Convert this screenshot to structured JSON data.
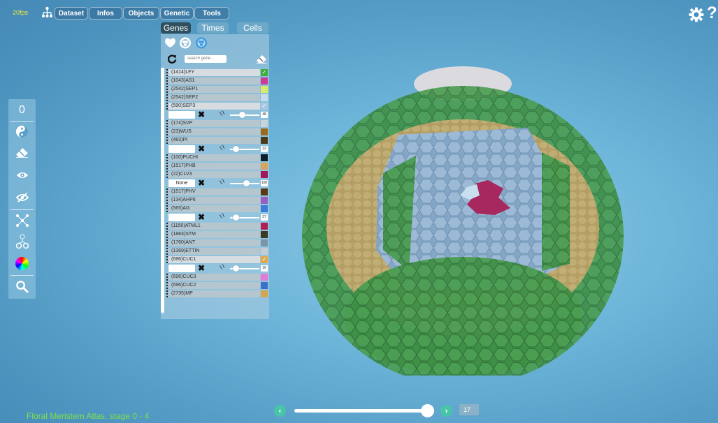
{
  "fps": "20fps",
  "menu": {
    "dataset": "Dataset",
    "infos": "Infos",
    "objects": "Objects",
    "genetic": "Genetic",
    "tools": "Tools"
  },
  "help_label": "?",
  "toolbar": {
    "counter": "0"
  },
  "tabs": {
    "genes": "Genes",
    "times": "Times",
    "cells": "Cells"
  },
  "search": {
    "placeholder": "search gene..."
  },
  "genes": [
    {
      "label": "(1414)LFY",
      "color": "#3fae3f",
      "checked": true,
      "highlight": true
    },
    {
      "label": "(1043)AS1",
      "color": "#cf3a98",
      "checked": false
    },
    {
      "label": "(2542)SEP1",
      "color": "#d8ec66",
      "checked": false
    },
    {
      "label": "(2542)SEP2",
      "color": "#c6dcee",
      "checked": false
    },
    {
      "label": "(590)SEP3",
      "color": "#a8c8e4",
      "checked": true,
      "highlight": true
    },
    {
      "label": "(174)SVP",
      "color": "#c9d4d8",
      "checked": false
    },
    {
      "label": "(23)WUS",
      "color": "#9b6b1b",
      "checked": false
    },
    {
      "label": "(483)PI",
      "color": "#4a3a1a",
      "checked": false
    },
    {
      "label": "(100)PUCHI",
      "color": "#0d2029",
      "checked": false
    },
    {
      "label": "(1517)PHB",
      "color": "#d6a55a",
      "checked": false
    },
    {
      "label": "(22)CLV3",
      "color": "#a0185a",
      "checked": false
    },
    {
      "label": "(1517)PHV",
      "color": "#5a3a12",
      "checked": false
    },
    {
      "label": "(134)AHP6",
      "color": "#9a5cc0",
      "checked": false
    },
    {
      "label": "(565)AG",
      "color": "#3a7ed8",
      "checked": false
    },
    {
      "label": "(1150)ATML1",
      "color": "#b02050",
      "checked": false
    },
    {
      "label": "(1883)STM",
      "color": "#3a3a25",
      "checked": false
    },
    {
      "label": "(1760)ANT",
      "color": "#7a94a8",
      "checked": false
    },
    {
      "label": "(1369)ETTIN",
      "color": "#c2ccd2",
      "checked": false
    },
    {
      "label": "(696)CUC1",
      "color": "#e0a84a",
      "checked": true,
      "highlight": true
    },
    {
      "label": "(696)CUC3",
      "color": "#e27ad6",
      "checked": false
    },
    {
      "label": "(696)CUC2",
      "color": "#3a72c8",
      "checked": false
    },
    {
      "label": "(2735)MP",
      "color": "#d8a64a",
      "checked": false
    }
  ],
  "controls": [
    {
      "after": "(590)SEP3",
      "box": "",
      "value": "48",
      "level": 0.4
    },
    {
      "after": "(483)PI",
      "box": "",
      "value": "22",
      "level": 0.2
    },
    {
      "after": "(22)CLV3",
      "box": "None",
      "value": "100",
      "level": 0.55
    },
    {
      "after": "(565)AG",
      "box": "",
      "value": "27",
      "level": 0.2
    },
    {
      "after": "(696)CUC1",
      "box": "",
      "value": "16",
      "level": 0.2
    }
  ],
  "icons": {
    "reset": "refresh-icon",
    "eraser": "eraser-icon",
    "settings": "gear-icon"
  },
  "footer": {
    "atlas": "Floral Meristem Atlas, stage 0 - 4",
    "time_value": "17",
    "time_level": 0.95
  },
  "colors": {
    "accent": "#48c4a8",
    "fps": "#f3e63a",
    "atlas": "#7fe04a"
  }
}
